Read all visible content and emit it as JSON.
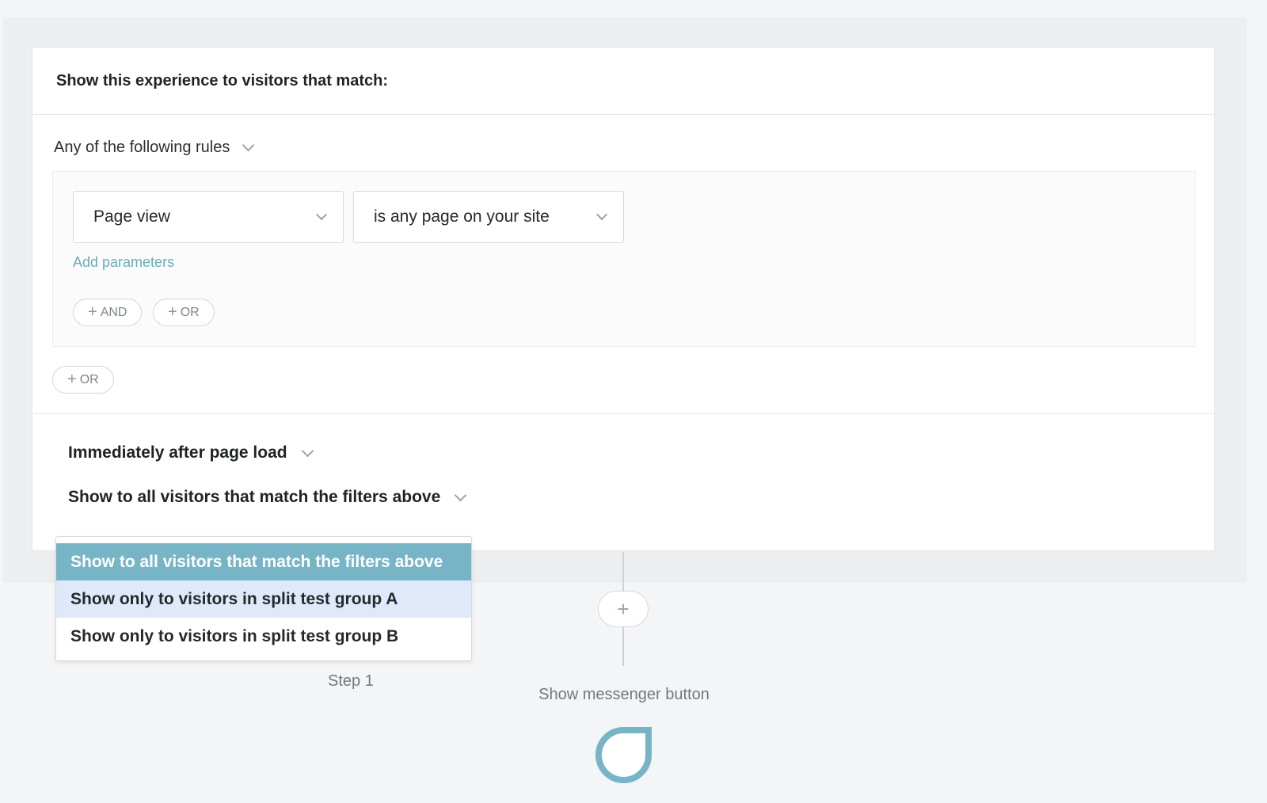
{
  "header": {
    "title": "Show this experience to visitors that match:"
  },
  "rules": {
    "mode_label": "Any of the following rules",
    "event_select": "Page view",
    "condition_select": "is any page on your site",
    "add_parameters": "Add parameters",
    "and_button": "AND",
    "or_button_inner": "OR",
    "or_button_outer": "OR",
    "plus_glyph": "+"
  },
  "timing": {
    "label": "Immediately after page load"
  },
  "audience": {
    "label": "Show to all visitors that match the filters above",
    "options": [
      "Show to all visitors that match the filters above",
      "Show only to visitors in split test group A",
      "Show only to visitors in split test group B"
    ]
  },
  "flow": {
    "add_step_glyph": "+",
    "step_label": "Step 1",
    "node_title": "Show messenger button",
    "icon": "messenger-bubble-icon"
  },
  "colors": {
    "accent": "#77b5c6",
    "link": "#6aacbd",
    "hover": "#dfe9fa"
  }
}
